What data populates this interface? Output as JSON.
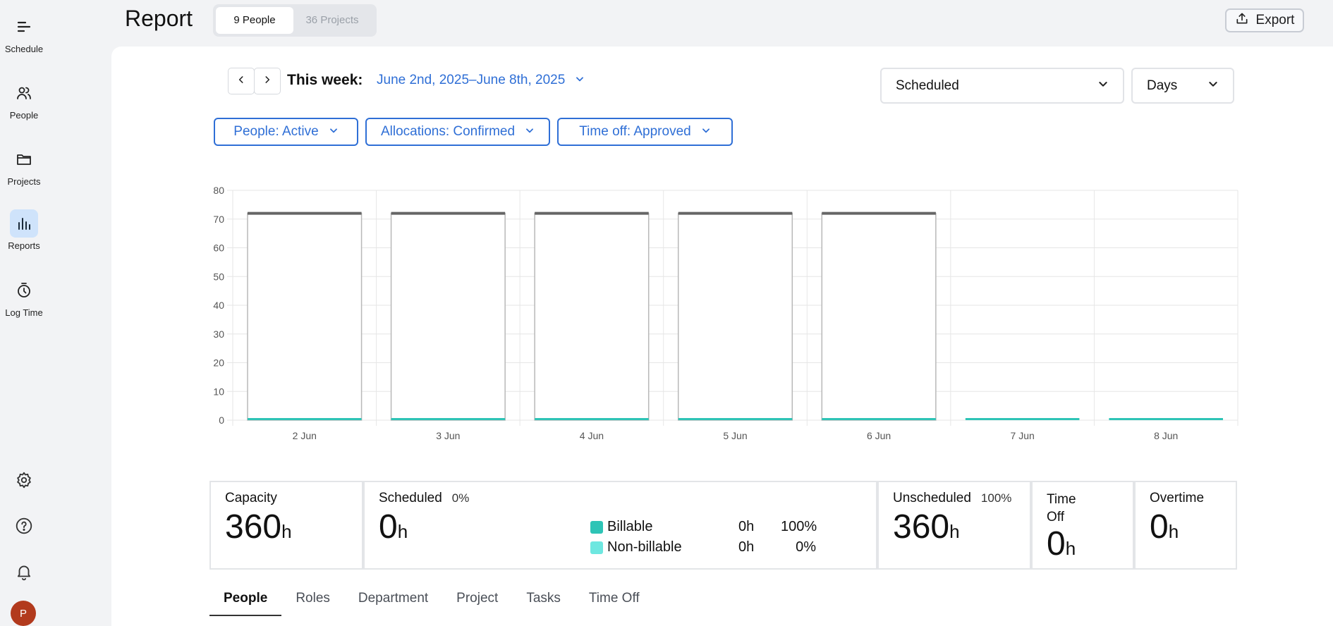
{
  "sidebar": {
    "items": [
      {
        "label": "Schedule",
        "icon": "schedule-icon"
      },
      {
        "label": "People",
        "icon": "people-icon"
      },
      {
        "label": "Projects",
        "icon": "folder-icon"
      },
      {
        "label": "Reports",
        "icon": "bar-chart-icon",
        "active": true
      },
      {
        "label": "Log Time",
        "icon": "stopwatch-icon"
      }
    ],
    "avatar_initial": "P"
  },
  "header": {
    "title": "Report",
    "toggle": {
      "people": "9 People",
      "projects": "36 Projects"
    },
    "export_label": "Export"
  },
  "toolbar": {
    "week_label": "This week:",
    "week_range": "June 2nd, 2025–June 8th, 2025",
    "metric_select": "Scheduled",
    "unit_select": "Days",
    "filters": [
      "People: Active",
      "Allocations: Confirmed",
      "Time off: Approved"
    ]
  },
  "chart_data": {
    "type": "bar",
    "categories": [
      "2 Jun",
      "3 Jun",
      "4 Jun",
      "5 Jun",
      "6 Jun",
      "7 Jun",
      "8 Jun"
    ],
    "capacity": [
      72,
      72,
      72,
      72,
      72,
      0,
      0
    ],
    "scheduled": [
      0,
      0,
      0,
      0,
      0,
      0,
      0
    ],
    "ylim": [
      0,
      80
    ],
    "yticks": [
      0,
      10,
      20,
      30,
      40,
      50,
      60,
      70,
      80
    ],
    "grid": true,
    "colors": {
      "capacity_line": "#666666",
      "bar_outline": "#b8b8b8",
      "scheduled": "#2ec4b6",
      "grid": "#e6e6e6"
    }
  },
  "stats": {
    "capacity": {
      "label": "Capacity",
      "value": "360",
      "unit": "h"
    },
    "scheduled": {
      "label": "Scheduled",
      "pct": "0%",
      "value": "0",
      "unit": "h"
    },
    "billable": {
      "label": "Billable",
      "hours": "0h",
      "pct": "100%",
      "color": "#2ec4b6"
    },
    "non_billable": {
      "label": "Non-billable",
      "hours": "0h",
      "pct": "0%",
      "color": "#6ee7e0"
    },
    "unscheduled": {
      "label": "Unscheduled",
      "pct": "100%",
      "value": "360",
      "unit": "h"
    },
    "time_off": {
      "label_line1": "Time",
      "label_line2": "Off",
      "value": "0",
      "unit": "h"
    },
    "overtime": {
      "label": "Overtime",
      "value": "0",
      "unit": "h"
    }
  },
  "tabs": [
    "People",
    "Roles",
    "Department",
    "Project",
    "Tasks",
    "Time Off"
  ],
  "active_tab": "People"
}
